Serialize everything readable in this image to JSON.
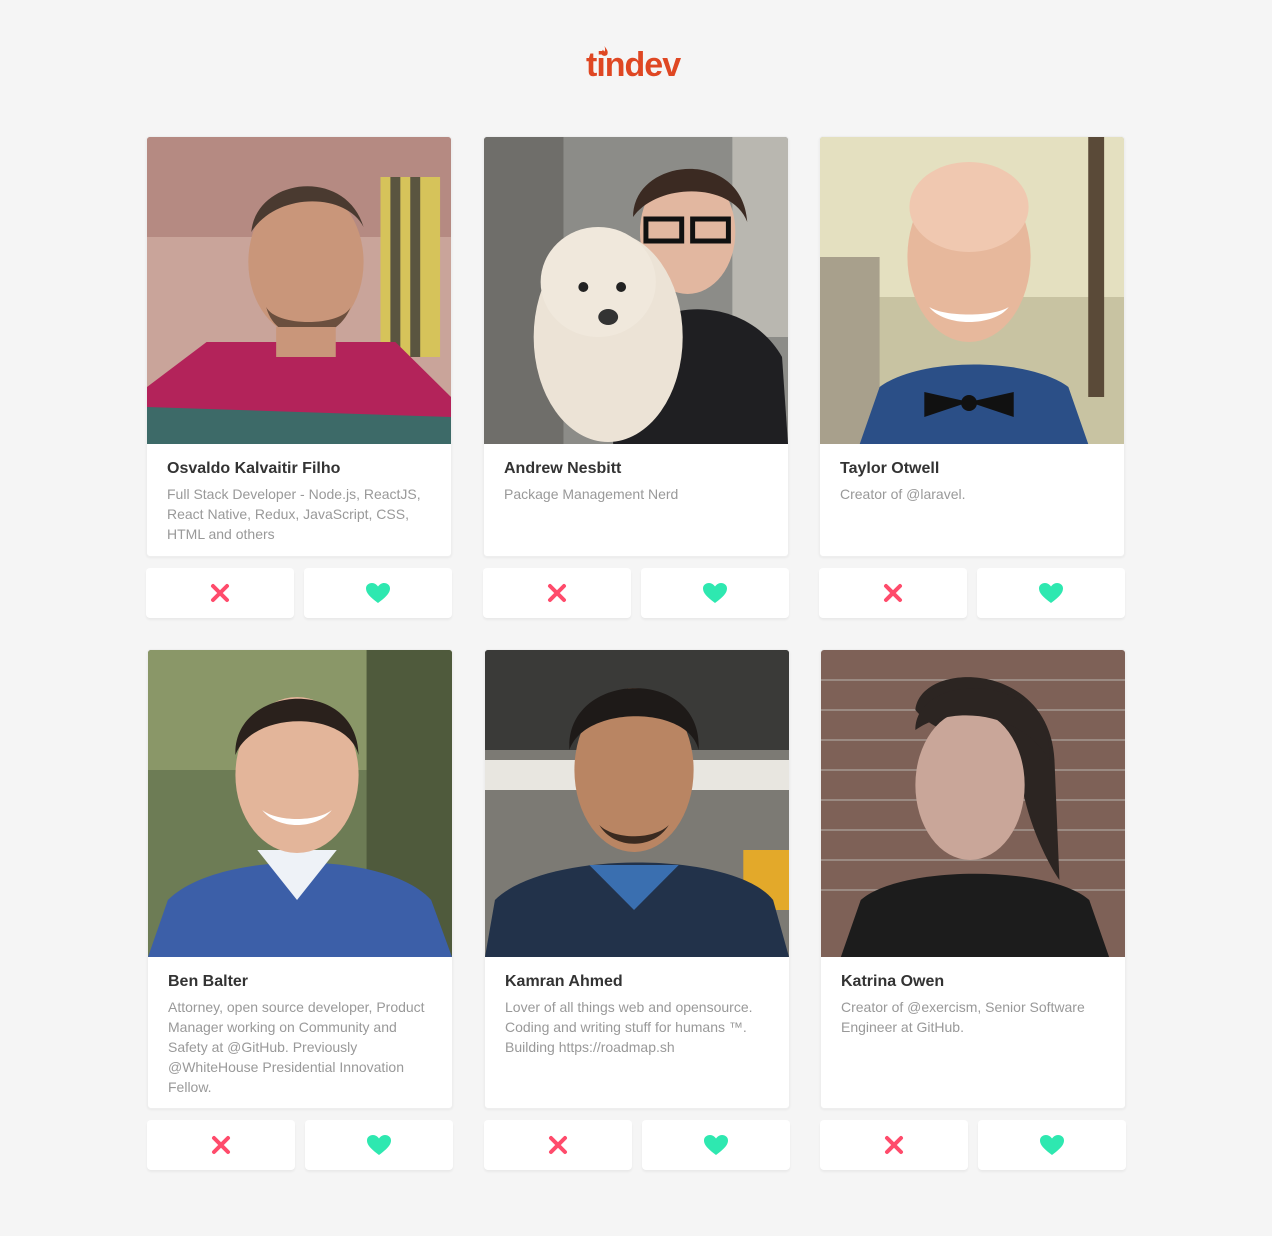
{
  "app": {
    "logo_text": "tindev"
  },
  "colors": {
    "brand": "#df4723",
    "dislike": "#ff4b6b",
    "like": "#2ee8b0",
    "background": "#f5f5f5"
  },
  "users": [
    {
      "name": "Osvaldo Kalvaitir Filho",
      "bio": "Full Stack Developer - Node.js, ReactJS, React Native, Redux, JavaScript, CSS, HTML and others",
      "avatar_icon": "avatar-photo"
    },
    {
      "name": "Andrew Nesbitt",
      "bio": "Package Management Nerd",
      "avatar_icon": "avatar-photo"
    },
    {
      "name": "Taylor Otwell",
      "bio": "Creator of @laravel.",
      "avatar_icon": "avatar-photo"
    },
    {
      "name": "Ben Balter",
      "bio": "Attorney, open source developer, Product Manager working on Community and Safety at @GitHub. Previously @WhiteHouse Presidential Innovation Fellow.",
      "avatar_icon": "avatar-photo"
    },
    {
      "name": "Kamran Ahmed",
      "bio": "Lover of all things web and opensource. Coding and writing stuff for humans ™. Building https://roadmap.sh",
      "avatar_icon": "avatar-photo"
    },
    {
      "name": "Katrina Owen",
      "bio": "Creator of @exercism, Senior Software Engineer at GitHub.",
      "avatar_icon": "avatar-photo"
    }
  ],
  "actions": {
    "dislike_icon": "x-icon",
    "like_icon": "heart-icon"
  }
}
